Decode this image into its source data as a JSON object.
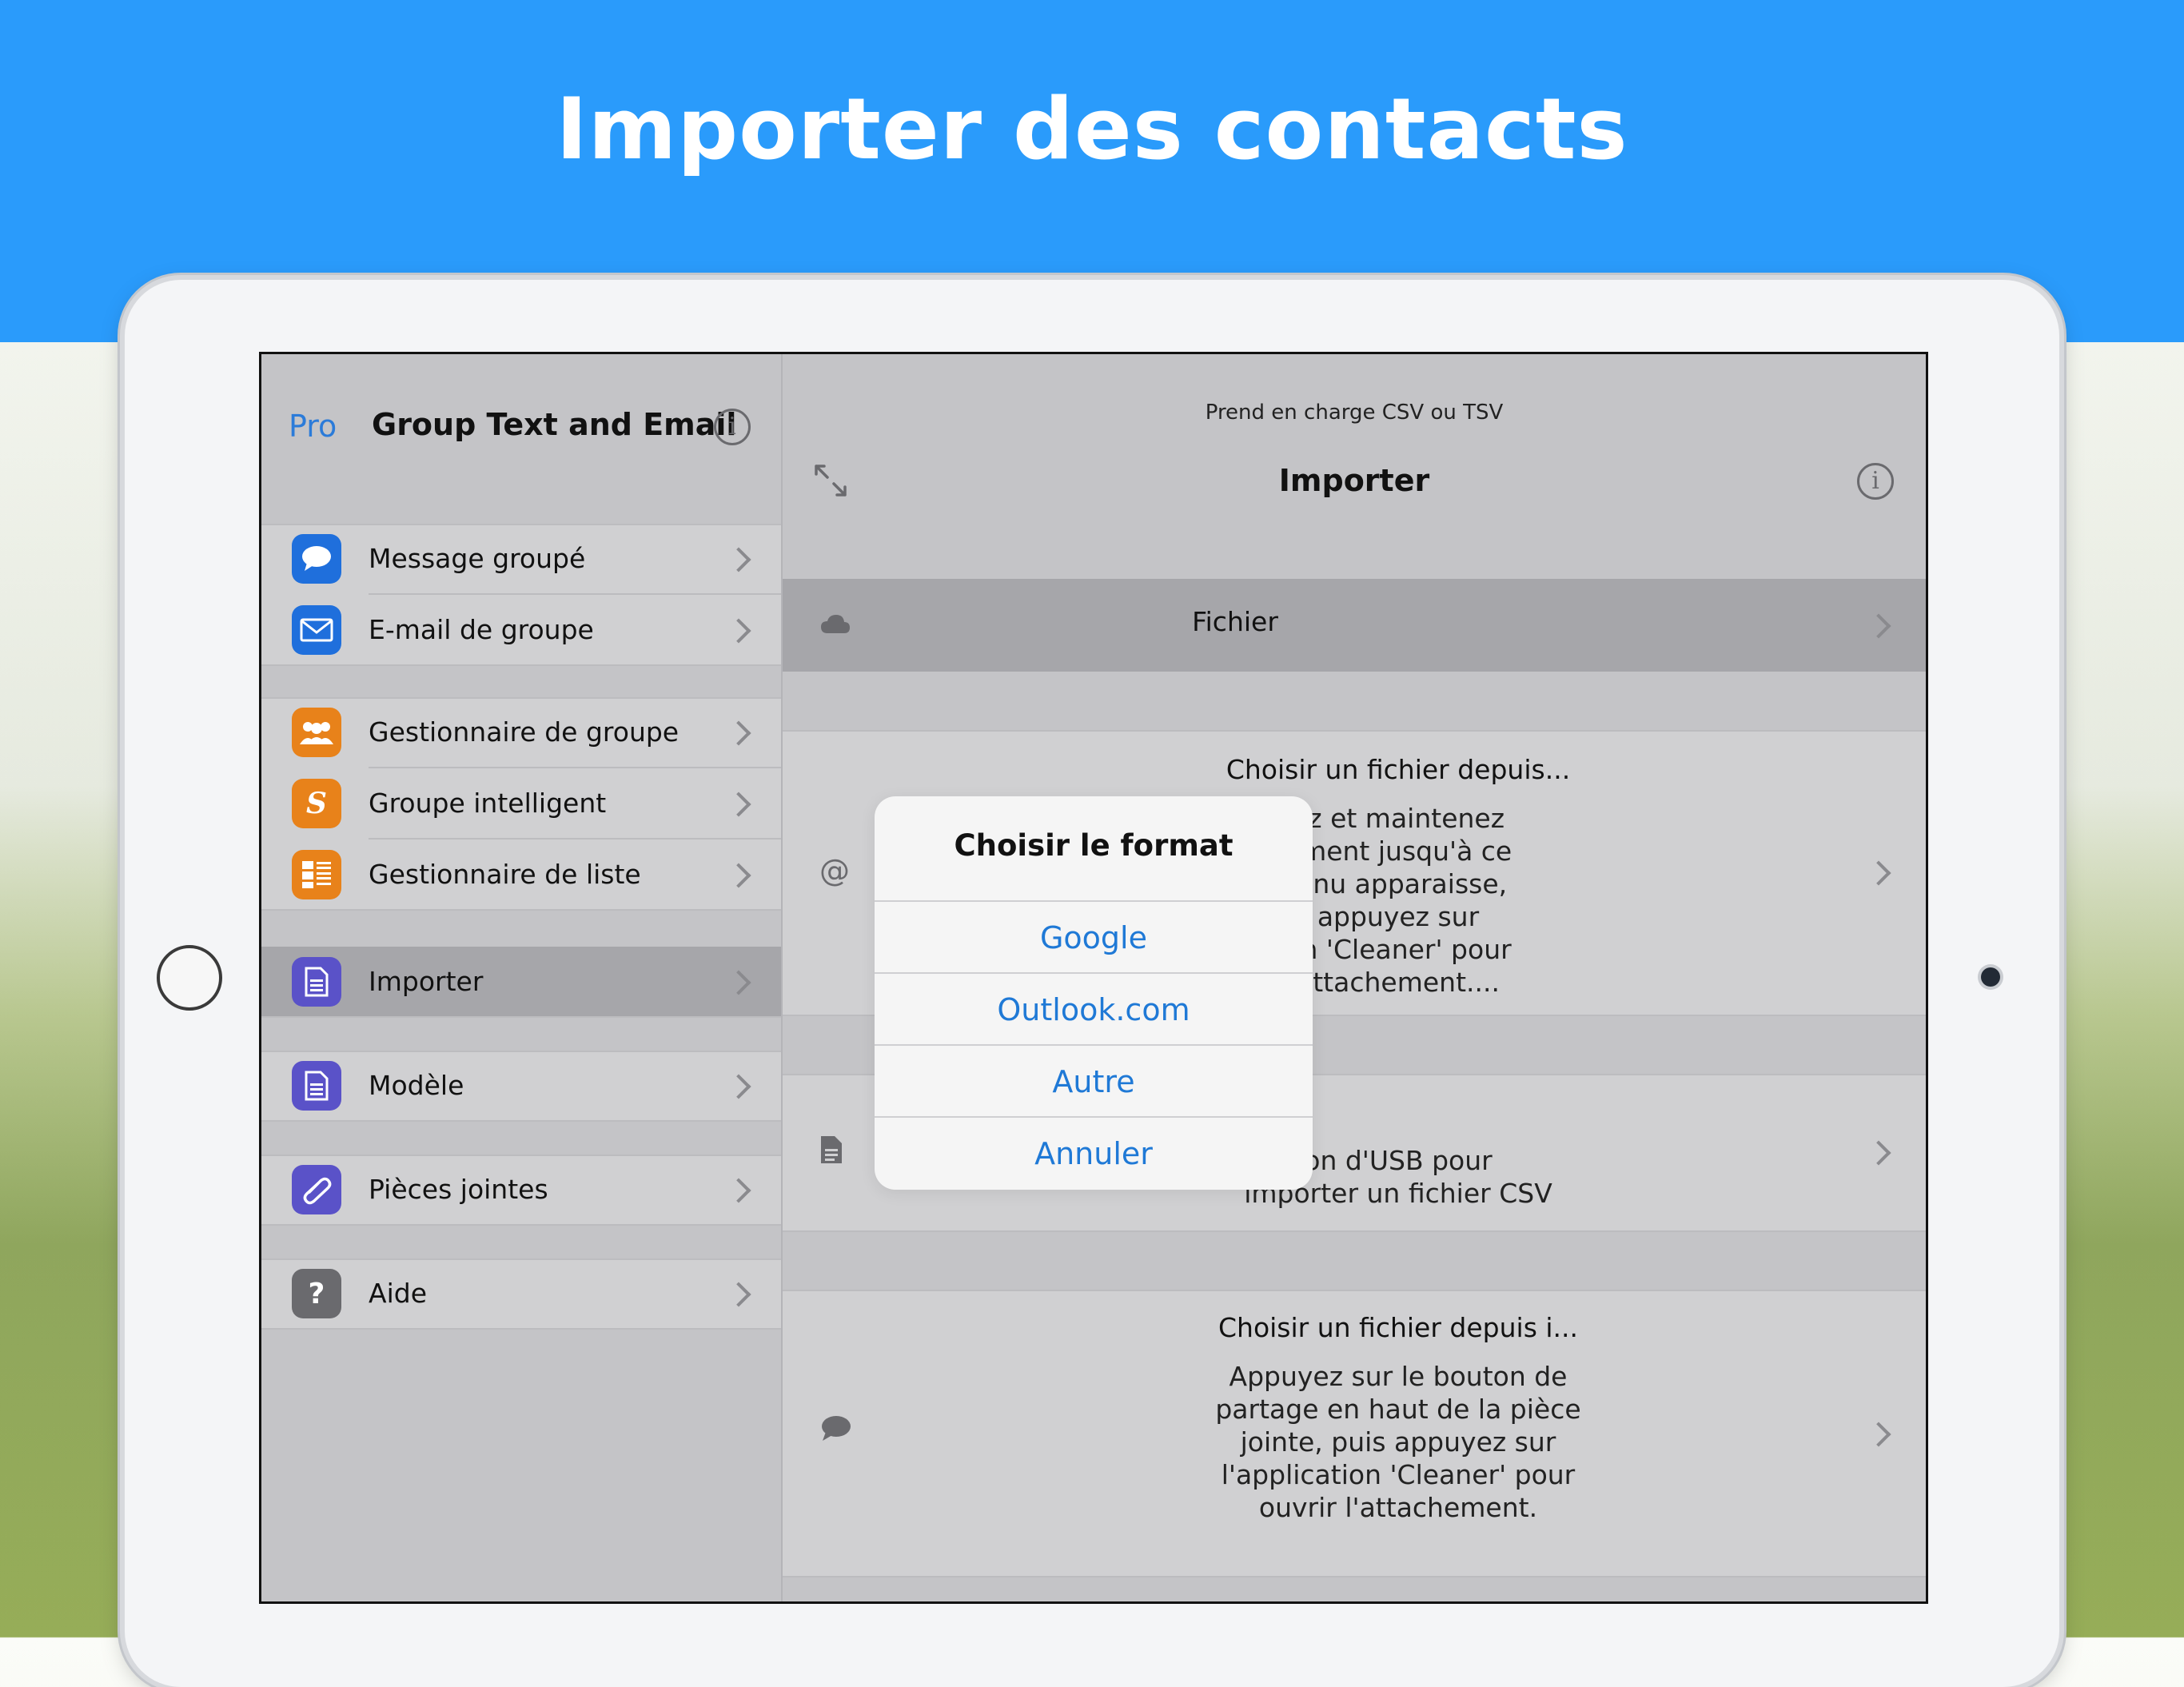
{
  "banner": {
    "title": "Importer des contacts"
  },
  "sidebar": {
    "pro_label": "Pro",
    "title": "Group Text and Email",
    "items": [
      {
        "label": "Message groupé",
        "icon": "message-bubble-icon",
        "color": "#1f6fdc"
      },
      {
        "label": "E-mail de groupe",
        "icon": "envelope-icon",
        "color": "#1f6fdc"
      },
      {
        "label": "Gestionnaire de groupe",
        "icon": "people-icon",
        "color": "#e8821a"
      },
      {
        "label": "Groupe intelligent",
        "icon": "smart-s-icon",
        "color": "#e8821a",
        "glyph": "S"
      },
      {
        "label": "Gestionnaire de liste",
        "icon": "list-icon",
        "color": "#e8821a"
      },
      {
        "label": "Importer",
        "icon": "import-document-icon",
        "color": "#5a52c8"
      },
      {
        "label": "Modèle",
        "icon": "template-document-icon",
        "color": "#5a52c8"
      },
      {
        "label": "Pièces jointes",
        "icon": "paperclip-icon",
        "color": "#5a52c8"
      },
      {
        "label": "Aide",
        "icon": "question-icon",
        "color": "#6a6a6e",
        "glyph": "?"
      }
    ]
  },
  "main": {
    "subtitle": "Prend en charge CSV ou TSV",
    "title": "Importer",
    "file_row": {
      "label": "Fichier"
    },
    "rows": [
      {
        "heading": "Choisir un fichier depuis...",
        "lines": [
          "ez et maintenez",
          "ement jusqu'à ce",
          "ienu apparaisse,",
          "appuyez sur",
          "on 'Cleaner' pour",
          "attachement...."
        ]
      },
      {
        "lines": [
          "on d'USB pour",
          "importer un fichier CSV"
        ]
      },
      {
        "heading": "Choisir un fichier depuis i...",
        "lines": [
          "Appuyez sur le bouton de",
          "partage en haut de la pièce",
          "jointe, puis appuyez sur",
          "l'application 'Cleaner' pour",
          "ouvrir l'attachement."
        ]
      }
    ]
  },
  "dialog": {
    "title": "Choisir le format",
    "buttons": [
      "Google",
      "Outlook.com",
      "Autre",
      "Annuler"
    ]
  },
  "colors": {
    "banner": "#2a9bfb",
    "link": "#1f79d6"
  }
}
